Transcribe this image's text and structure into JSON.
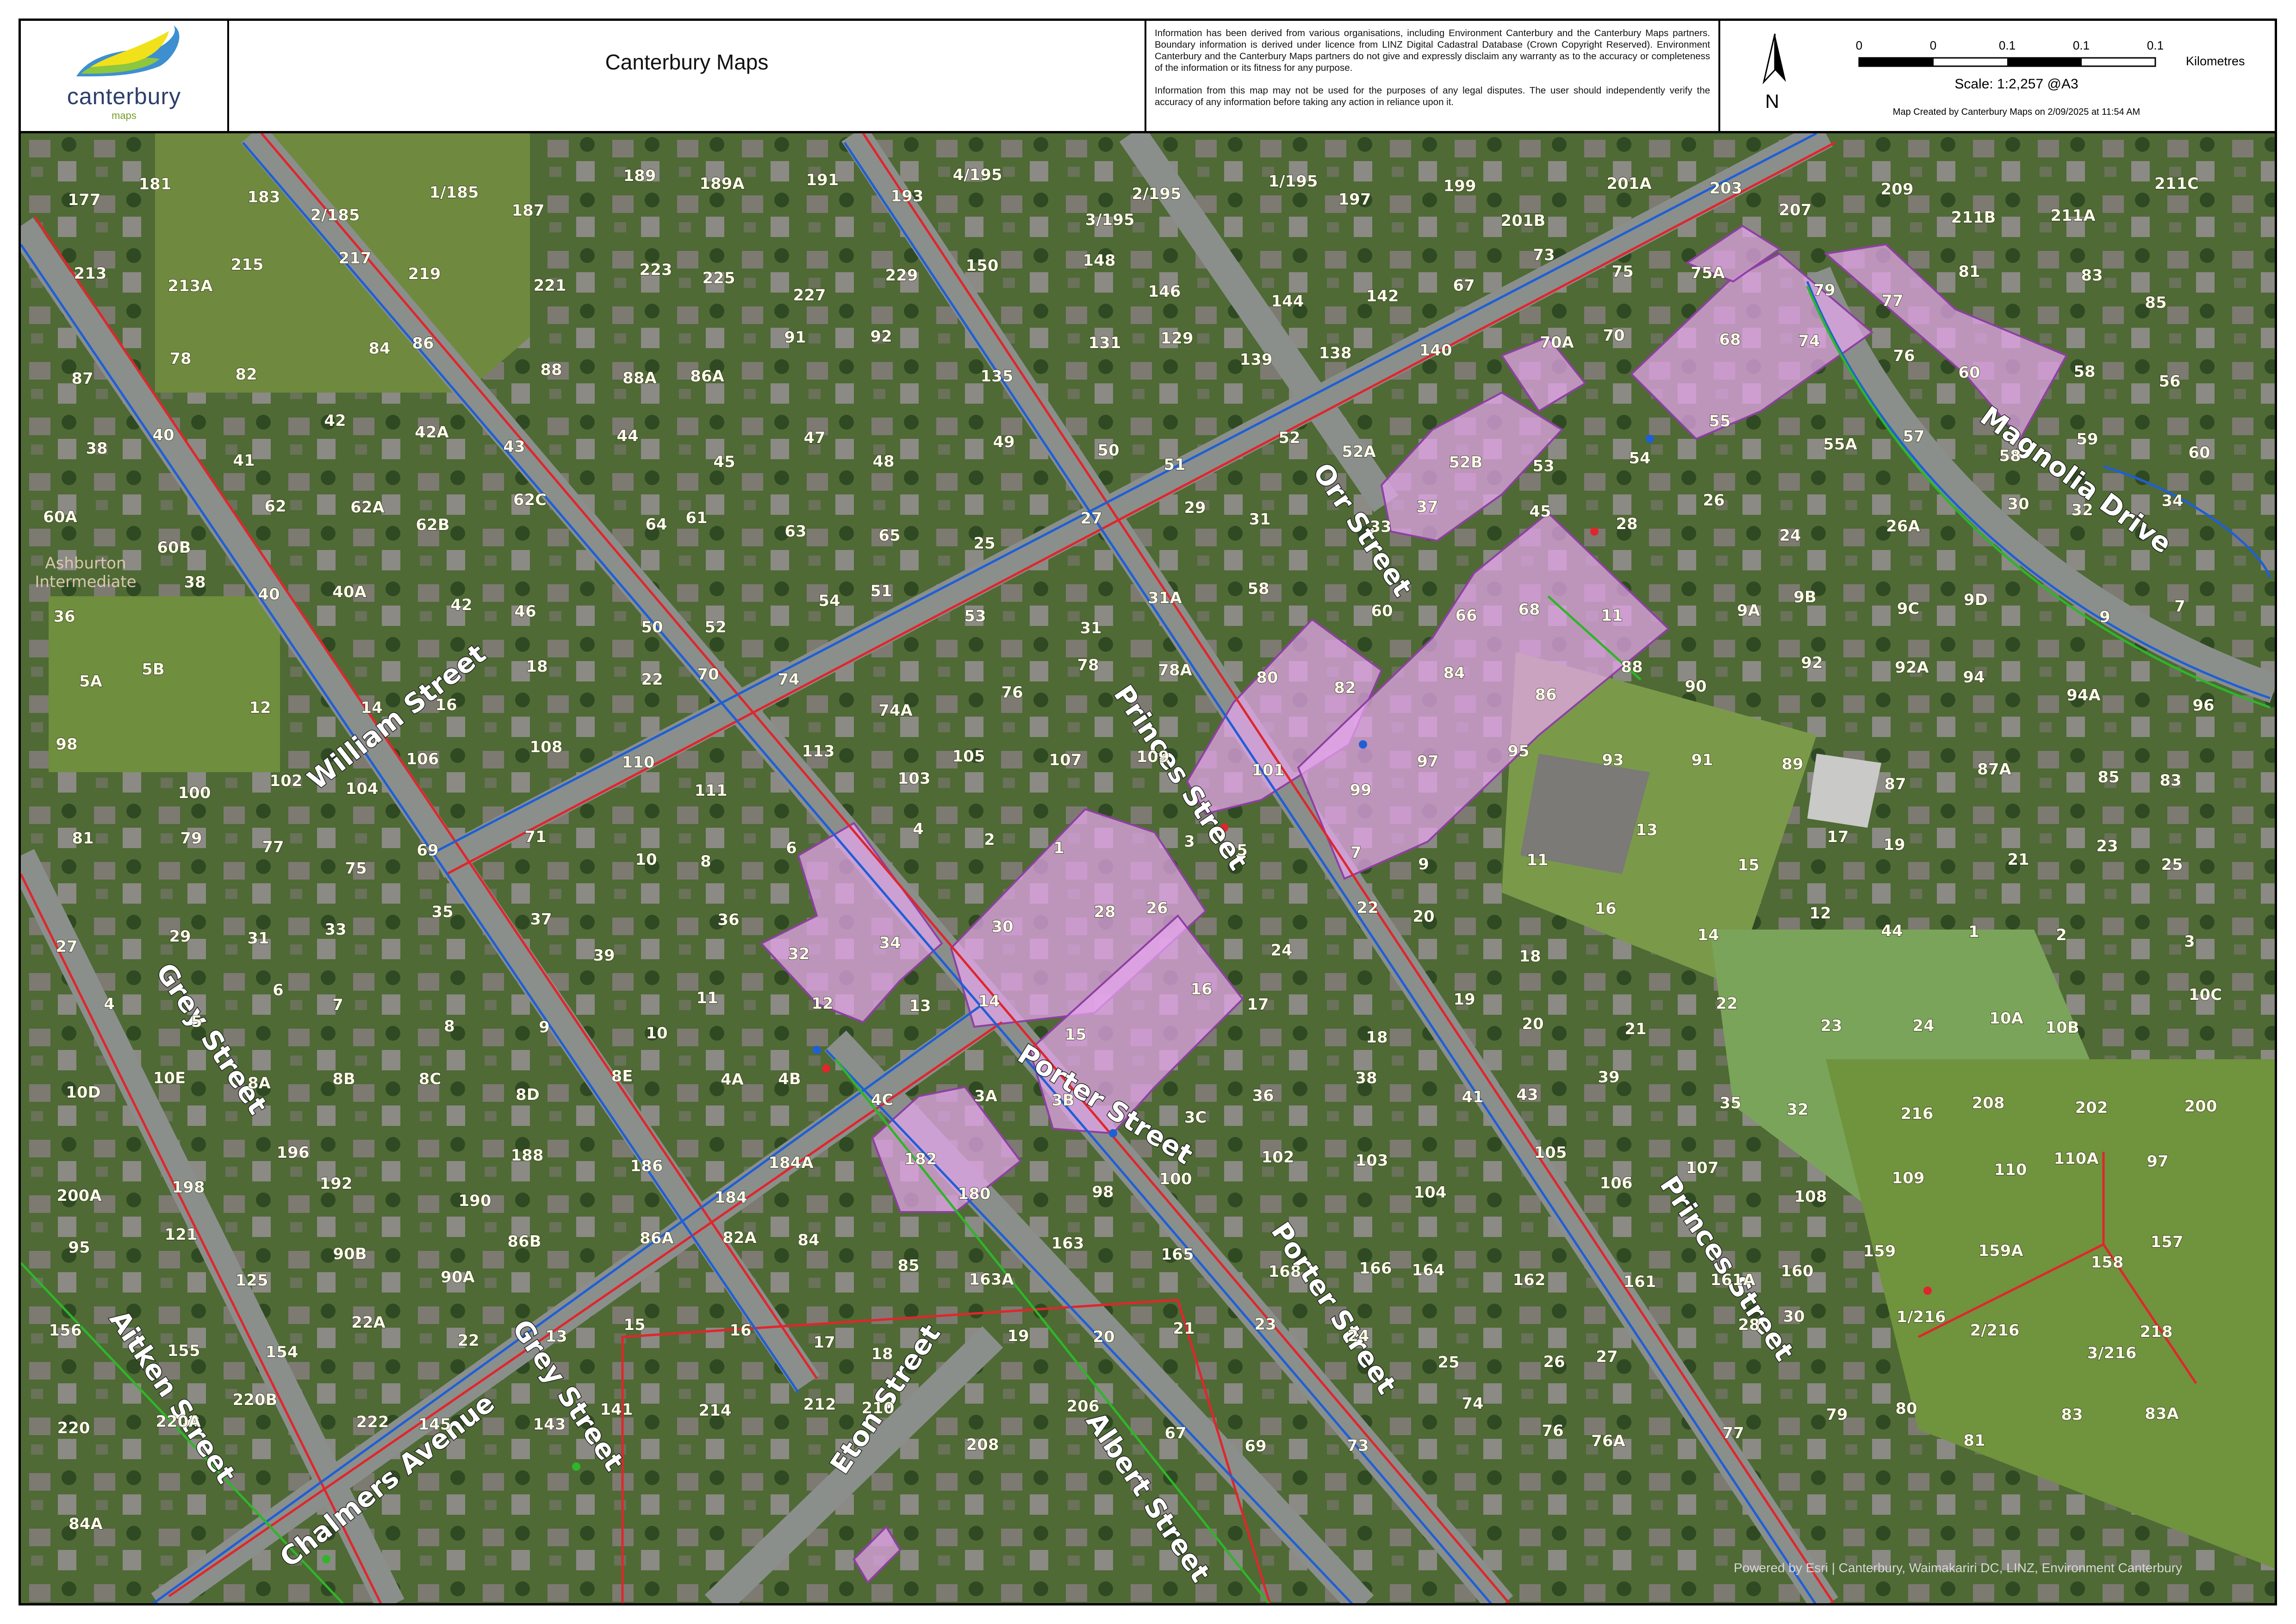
{
  "header": {
    "logo_text": "canterbury",
    "logo_sub": "maps",
    "title": "Canterbury Maps",
    "disclaimer_1": "Information has been derived from various organisations, including Environment Canterbury and the Canterbury Maps partners. Boundary information is derived under licence from LINZ Digital Cadastral Database (Crown Copyright Reserved). Environment Canterbury and the Canterbury Maps partners do not give and expressly disclaim any warranty as to the accuracy or completeness of the information or its fitness for any purpose.",
    "disclaimer_2": "Information from this map may not be used for the purposes of any legal disputes. The user should independently verify the accuracy of any information before taking any action in reliance upon it.",
    "north_label": "N",
    "scale_ticks": [
      "0",
      "0",
      "0.1",
      "0.1",
      "0.1"
    ],
    "scale_units": "Kilometres",
    "scale_text": "Scale: 1:2,257 @A3",
    "created_text": "Map Created by Canterbury Maps on 2/09/2025 at 11:54 AM"
  },
  "map": {
    "street_labels": [
      "William Street",
      "Grey Street",
      "Grey Street",
      "Aitken Street",
      "Chalmers Avenue",
      "Eton Street",
      "Albert Street",
      "Porter Street",
      "Porter Street",
      "Princes Street",
      "Princes Street",
      "Orr Street",
      "Magnolia Drive"
    ],
    "poi_label_lines": [
      "Ashburton",
      "Intermediate"
    ],
    "address_labels": [
      "177",
      "181",
      "183",
      "2/185",
      "1/185",
      "187",
      "189",
      "189A",
      "191",
      "193",
      "4/195",
      "3/195",
      "2/195",
      "1/195",
      "197",
      "199",
      "201B",
      "201A",
      "203",
      "207",
      "209",
      "211B",
      "211A",
      "211C",
      "213",
      "213A",
      "215",
      "217",
      "219",
      "221",
      "223",
      "225",
      "227",
      "229",
      "150",
      "148",
      "146",
      "144",
      "142",
      "67",
      "73",
      "75",
      "75A",
      "79",
      "77",
      "81",
      "83",
      "85",
      "87",
      "78",
      "82",
      "84",
      "86",
      "88",
      "88A",
      "86A",
      "91",
      "92",
      "135",
      "131",
      "129",
      "139",
      "138",
      "140",
      "70A",
      "70",
      "68",
      "74",
      "76",
      "60",
      "58",
      "56",
      "38",
      "40",
      "41",
      "42",
      "42A",
      "43",
      "44",
      "45",
      "47",
      "48",
      "49",
      "50",
      "51",
      "52",
      "52A",
      "52B",
      "53",
      "54",
      "55",
      "55A",
      "57",
      "58",
      "59",
      "60",
      "60A",
      "60B",
      "62",
      "62A",
      "62B",
      "62C",
      "64",
      "61",
      "63",
      "65",
      "25",
      "27",
      "29",
      "31",
      "33",
      "37",
      "45",
      "28",
      "26",
      "24",
      "26A",
      "30",
      "32",
      "34",
      "36",
      "38",
      "40",
      "40A",
      "42",
      "46",
      "50",
      "52",
      "54",
      "51",
      "53",
      "31",
      "31A",
      "58",
      "60",
      "66",
      "68",
      "11",
      "9A",
      "9B",
      "9C",
      "9D",
      "9",
      "7",
      "5A",
      "5B",
      "12",
      "14",
      "16",
      "18",
      "22",
      "70",
      "74",
      "74A",
      "76",
      "78",
      "78A",
      "80",
      "82",
      "84",
      "86",
      "88",
      "90",
      "92",
      "92A",
      "94",
      "94A",
      "96",
      "98",
      "100",
      "102",
      "104",
      "106",
      "108",
      "110",
      "111",
      "113",
      "103",
      "105",
      "107",
      "109",
      "101",
      "99",
      "97",
      "95",
      "93",
      "91",
      "89",
      "87",
      "87A",
      "85",
      "83",
      "81",
      "79",
      "77",
      "75",
      "69",
      "71",
      "10",
      "8",
      "6",
      "4",
      "2",
      "1",
      "3",
      "5",
      "7",
      "9",
      "11",
      "13",
      "15",
      "17",
      "19",
      "21",
      "23",
      "25",
      "27",
      "29",
      "31",
      "33",
      "35",
      "37",
      "39",
      "36",
      "32",
      "34",
      "30",
      "28",
      "26",
      "24",
      "22",
      "20",
      "18",
      "16",
      "14",
      "12",
      "44",
      "1",
      "2",
      "3",
      "4",
      "5",
      "6",
      "7",
      "8",
      "9",
      "10",
      "11",
      "12",
      "13",
      "14",
      "15",
      "16",
      "17",
      "18",
      "19",
      "20",
      "21",
      "22",
      "23",
      "24",
      "10A",
      "10B",
      "10C",
      "10D",
      "10E",
      "8A",
      "8B",
      "8C",
      "8D",
      "8E",
      "4A",
      "4B",
      "4C",
      "3A",
      "3B",
      "3C",
      "36",
      "38",
      "41",
      "43",
      "39",
      "35",
      "32",
      "216",
      "208",
      "202",
      "200",
      "200A",
      "198",
      "196",
      "192",
      "190",
      "188",
      "186",
      "184",
      "184A",
      "182",
      "180",
      "98",
      "100",
      "102",
      "103",
      "104",
      "105",
      "106",
      "107",
      "108",
      "109",
      "110",
      "110A",
      "97",
      "95",
      "121",
      "125",
      "90B",
      "90A",
      "86B",
      "86A",
      "82A",
      "84",
      "85",
      "163A",
      "163",
      "165",
      "168",
      "166",
      "164",
      "162",
      "161",
      "161A",
      "160",
      "159",
      "159A",
      "158",
      "157",
      "156",
      "155",
      "154",
      "22A",
      "22",
      "13",
      "15",
      "16",
      "17",
      "18",
      "19",
      "20",
      "21",
      "23",
      "24",
      "25",
      "26",
      "27",
      "28",
      "30",
      "1/216",
      "2/216",
      "3/216",
      "218",
      "220",
      "220A",
      "220B",
      "222",
      "145",
      "143",
      "141",
      "214",
      "212",
      "210",
      "208",
      "206",
      "67",
      "69",
      "73",
      "74",
      "76",
      "76A",
      "77",
      "79",
      "80",
      "81",
      "83",
      "83A",
      "84A"
    ],
    "attribution": "Powered by Esri | Canterbury, Waimakariri DC, LINZ, Environment Canterbury",
    "colors": {
      "parcel_highlight": "#e7a6ee",
      "parcel_outline": "#8e3fa3",
      "water_main": "#1f5fd6",
      "wastewater": "#e0262c",
      "stormwater": "#2fb52a",
      "boundary": "#222222"
    }
  }
}
